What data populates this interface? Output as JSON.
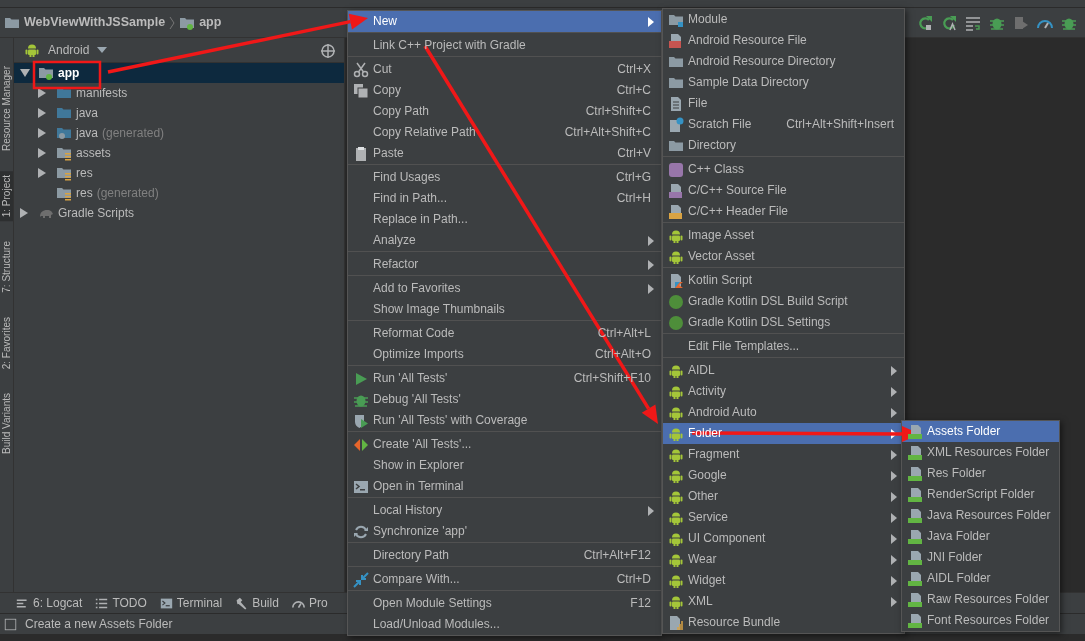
{
  "toolbar": {
    "breadcrumbs": [
      {
        "label": "WebViewWithJSSample"
      },
      {
        "label": "app"
      }
    ]
  },
  "tool_strip": [
    {
      "label": "Resource Manager",
      "selected": false
    },
    {
      "label": "1: Project",
      "selected": true
    },
    {
      "label": "7: Structure",
      "selected": false
    },
    {
      "label": "2: Favorites",
      "selected": false
    },
    {
      "label": "Build Variants",
      "selected": false
    }
  ],
  "project_panel": {
    "view": "Android",
    "tree": [
      {
        "label": "app",
        "selected": true,
        "expanded": true,
        "children": [
          {
            "label": "manifests",
            "selected": false,
            "expanded": false
          },
          {
            "label": "java",
            "selected": false,
            "expanded": false
          },
          {
            "label": "java",
            "note": "(generated)",
            "selected": false,
            "expanded": false
          },
          {
            "label": "assets",
            "selected": false,
            "expanded": false
          },
          {
            "label": "res",
            "selected": false,
            "expanded": false
          },
          {
            "label": "res",
            "note": "(generated)",
            "selected": false
          }
        ]
      },
      {
        "label": "Gradle Scripts",
        "selected": false,
        "expanded": false
      }
    ]
  },
  "bottom_tabs": [
    {
      "label": "6: Logcat"
    },
    {
      "label": "TODO"
    },
    {
      "label": "Terminal"
    },
    {
      "label": "Build"
    },
    {
      "label": "Pro"
    }
  ],
  "status_bar": {
    "message": "Create a new Assets Folder"
  },
  "context_menu": {
    "items": [
      {
        "kind": "item",
        "label": "New",
        "submenu": true,
        "selected": true
      },
      {
        "kind": "separator"
      },
      {
        "kind": "item",
        "label": "Link C++ Project with Gradle",
        "selected": false
      },
      {
        "kind": "separator"
      },
      {
        "kind": "item",
        "label": "Cut",
        "shortcut": "Ctrl+X",
        "selected": false
      },
      {
        "kind": "item",
        "label": "Copy",
        "shortcut": "Ctrl+C",
        "selected": false
      },
      {
        "kind": "item",
        "label": "Copy Path",
        "shortcut": "Ctrl+Shift+C",
        "selected": false
      },
      {
        "kind": "item",
        "label": "Copy Relative Path",
        "shortcut": "Ctrl+Alt+Shift+C",
        "selected": false
      },
      {
        "kind": "item",
        "label": "Paste",
        "shortcut": "Ctrl+V",
        "selected": false
      },
      {
        "kind": "separator"
      },
      {
        "kind": "item",
        "label": "Find Usages",
        "shortcut": "Ctrl+G",
        "selected": false
      },
      {
        "kind": "item",
        "label": "Find in Path...",
        "shortcut": "Ctrl+H",
        "selected": false
      },
      {
        "kind": "item",
        "label": "Replace in Path...",
        "selected": false
      },
      {
        "kind": "item",
        "label": "Analyze",
        "submenu": true,
        "selected": false
      },
      {
        "kind": "separator"
      },
      {
        "kind": "item",
        "label": "Refactor",
        "submenu": true,
        "selected": false
      },
      {
        "kind": "separator"
      },
      {
        "kind": "item",
        "label": "Add to Favorites",
        "submenu": true,
        "selected": false
      },
      {
        "kind": "item",
        "label": "Show Image Thumbnails",
        "selected": false
      },
      {
        "kind": "separator"
      },
      {
        "kind": "item",
        "label": "Reformat Code",
        "shortcut": "Ctrl+Alt+L",
        "selected": false
      },
      {
        "kind": "item",
        "label": "Optimize Imports",
        "shortcut": "Ctrl+Alt+O",
        "selected": false
      },
      {
        "kind": "separator"
      },
      {
        "kind": "item",
        "label": "Run 'All Tests'",
        "shortcut": "Ctrl+Shift+F10",
        "selected": false
      },
      {
        "kind": "item",
        "label": "Debug 'All Tests'",
        "selected": false
      },
      {
        "kind": "item",
        "label": "Run 'All Tests' with Coverage",
        "selected": false
      },
      {
        "kind": "separator"
      },
      {
        "kind": "item",
        "label": "Create 'All Tests'...",
        "selected": false
      },
      {
        "kind": "item",
        "label": "Show in Explorer",
        "selected": false
      },
      {
        "kind": "item",
        "label": "Open in Terminal",
        "selected": false
      },
      {
        "kind": "separator"
      },
      {
        "kind": "item",
        "label": "Local History",
        "submenu": true,
        "selected": false
      },
      {
        "kind": "item",
        "label": "Synchronize 'app'",
        "selected": false
      },
      {
        "kind": "separator"
      },
      {
        "kind": "item",
        "label": "Directory Path",
        "shortcut": "Ctrl+Alt+F12",
        "selected": false
      },
      {
        "kind": "separator"
      },
      {
        "kind": "item",
        "label": "Compare With...",
        "shortcut": "Ctrl+D",
        "selected": false
      },
      {
        "kind": "separator"
      },
      {
        "kind": "item",
        "label": "Open Module Settings",
        "shortcut": "F12",
        "selected": false
      },
      {
        "kind": "item",
        "label": "Load/Unload Modules...",
        "selected": false
      }
    ]
  },
  "new_submenu": {
    "items": [
      {
        "kind": "item",
        "label": "Module",
        "selected": false
      },
      {
        "kind": "item",
        "label": "Android Resource File",
        "selected": false
      },
      {
        "kind": "item",
        "label": "Android Resource Directory",
        "selected": false
      },
      {
        "kind": "item",
        "label": "Sample Data Directory",
        "selected": false
      },
      {
        "kind": "item",
        "label": "File",
        "selected": false
      },
      {
        "kind": "item",
        "label": "Scratch File",
        "shortcut": "Ctrl+Alt+Shift+Insert",
        "selected": false
      },
      {
        "kind": "item",
        "label": "Directory",
        "selected": false
      },
      {
        "kind": "separator"
      },
      {
        "kind": "item",
        "label": "C++ Class",
        "selected": false
      },
      {
        "kind": "item",
        "label": "C/C++ Source File",
        "selected": false
      },
      {
        "kind": "item",
        "label": "C/C++ Header File",
        "selected": false
      },
      {
        "kind": "separator"
      },
      {
        "kind": "item",
        "label": "Image Asset",
        "selected": false
      },
      {
        "kind": "item",
        "label": "Vector Asset",
        "selected": false
      },
      {
        "kind": "separator"
      },
      {
        "kind": "item",
        "label": "Kotlin Script",
        "selected": false
      },
      {
        "kind": "item",
        "label": "Gradle Kotlin DSL Build Script",
        "selected": false
      },
      {
        "kind": "item",
        "label": "Gradle Kotlin DSL Settings",
        "selected": false
      },
      {
        "kind": "separator"
      },
      {
        "kind": "item",
        "label": "Edit File Templates...",
        "selected": false
      },
      {
        "kind": "separator"
      },
      {
        "kind": "item",
        "label": "AIDL",
        "submenu": true,
        "selected": false
      },
      {
        "kind": "item",
        "label": "Activity",
        "submenu": true,
        "selected": false
      },
      {
        "kind": "item",
        "label": "Android Auto",
        "submenu": true,
        "selected": false
      },
      {
        "kind": "item",
        "label": "Folder",
        "submenu": true,
        "selected": true
      },
      {
        "kind": "item",
        "label": "Fragment",
        "submenu": true,
        "selected": false
      },
      {
        "kind": "item",
        "label": "Google",
        "submenu": true,
        "selected": false
      },
      {
        "kind": "item",
        "label": "Other",
        "submenu": true,
        "selected": false
      },
      {
        "kind": "item",
        "label": "Service",
        "submenu": true,
        "selected": false
      },
      {
        "kind": "item",
        "label": "UI Component",
        "submenu": true,
        "selected": false
      },
      {
        "kind": "item",
        "label": "Wear",
        "submenu": true,
        "selected": false
      },
      {
        "kind": "item",
        "label": "Widget",
        "submenu": true,
        "selected": false
      },
      {
        "kind": "item",
        "label": "XML",
        "submenu": true,
        "selected": false
      },
      {
        "kind": "item",
        "label": "Resource Bundle",
        "selected": false
      }
    ]
  },
  "folder_submenu": {
    "items": [
      {
        "kind": "item",
        "label": "Assets Folder",
        "selected": true
      },
      {
        "kind": "item",
        "label": "XML Resources Folder",
        "selected": false
      },
      {
        "kind": "item",
        "label": "Res Folder",
        "selected": false
      },
      {
        "kind": "item",
        "label": "RenderScript Folder",
        "selected": false
      },
      {
        "kind": "item",
        "label": "Java Resources Folder",
        "selected": false
      },
      {
        "kind": "item",
        "label": "Java Folder",
        "selected": false
      },
      {
        "kind": "item",
        "label": "JNI Folder",
        "selected": false
      },
      {
        "kind": "item",
        "label": "AIDL Folder",
        "selected": false
      },
      {
        "kind": "item",
        "label": "Raw Resources Folder",
        "selected": false
      },
      {
        "kind": "item",
        "label": "Font Resources Folder",
        "selected": false
      }
    ]
  }
}
